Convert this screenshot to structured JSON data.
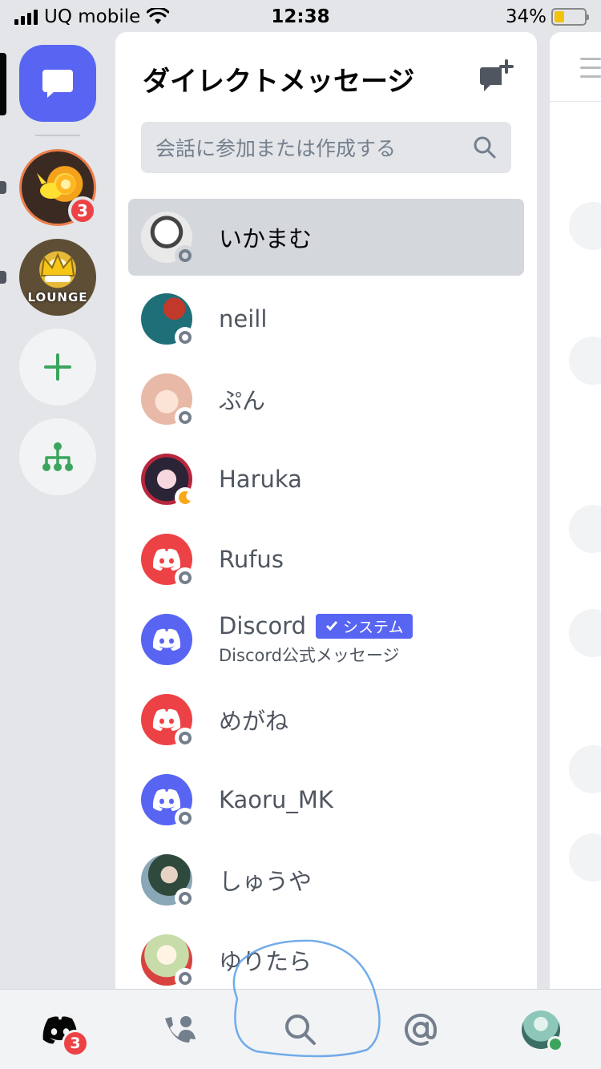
{
  "status_bar": {
    "carrier": "UQ mobile",
    "time": "12:38",
    "battery": "34%",
    "battery_level": 0.34
  },
  "rail": {
    "servers": [
      {
        "name": "server-pikachu",
        "badge": "3"
      },
      {
        "name": "server-lounge",
        "label": "LOUNGE"
      }
    ]
  },
  "dm": {
    "title": "ダイレクトメッセージ",
    "search_placeholder": "会話に参加または作成する",
    "conversations": [
      {
        "name": "いかまむ",
        "status": "offline",
        "active": true
      },
      {
        "name": "neill",
        "status": "offline"
      },
      {
        "name": "ぷん",
        "status": "offline"
      },
      {
        "name": "Haruka",
        "status": "idle"
      },
      {
        "name": "Rufus",
        "status": "offline"
      },
      {
        "name": "Discord",
        "badge": "システム",
        "subtitle": "Discord公式メッセージ"
      },
      {
        "name": "めがね",
        "status": "offline"
      },
      {
        "name": "Kaoru_MK",
        "status": "offline"
      },
      {
        "name": "しゅうや",
        "status": "offline"
      },
      {
        "name": "ゆりたら",
        "status": "offline"
      }
    ]
  },
  "tabbar": {
    "home_badge": "3",
    "tabs": [
      "home",
      "friends",
      "search",
      "mentions",
      "profile"
    ]
  },
  "colors": {
    "blurple": "#5865f2",
    "red": "#ed4245",
    "green": "#3ba55d",
    "idle": "#faa81a",
    "offline": "#747f8d"
  }
}
